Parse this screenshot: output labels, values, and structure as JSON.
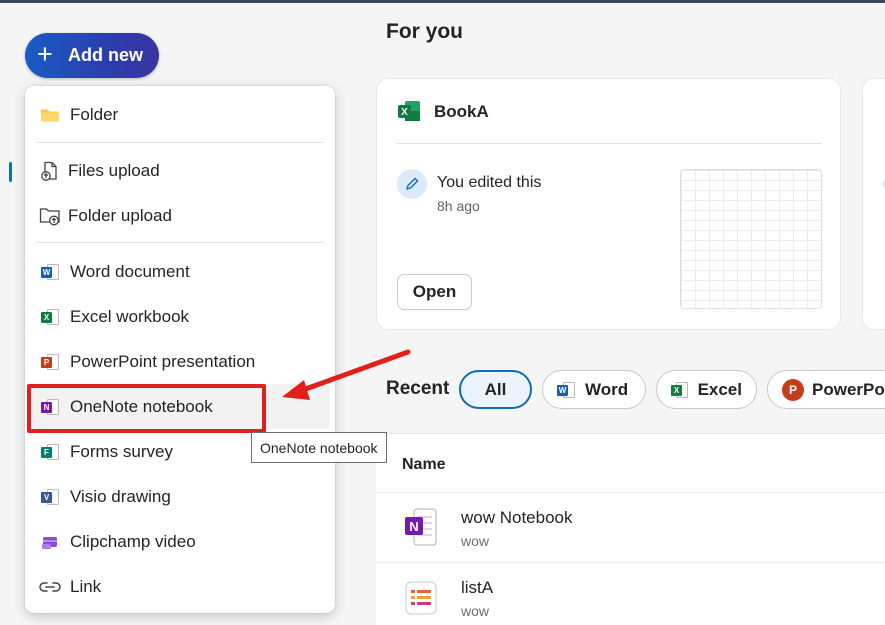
{
  "add_new": {
    "label": "Add new",
    "icon": "plus-icon"
  },
  "menu": {
    "items": [
      {
        "label": "Folder",
        "icon": "folder-icon"
      },
      {
        "label": "Files upload",
        "icon": "file-upload-icon"
      },
      {
        "label": "Folder upload",
        "icon": "folder-upload-icon"
      },
      {
        "label": "Word document",
        "icon": "word-icon"
      },
      {
        "label": "Excel workbook",
        "icon": "excel-icon"
      },
      {
        "label": "PowerPoint presentation",
        "icon": "powerpoint-icon"
      },
      {
        "label": "OneNote notebook",
        "icon": "onenote-icon"
      },
      {
        "label": "Forms survey",
        "icon": "forms-icon"
      },
      {
        "label": "Visio drawing",
        "icon": "visio-icon"
      },
      {
        "label": "Clipchamp video",
        "icon": "clipchamp-icon"
      },
      {
        "label": "Link",
        "icon": "link-icon"
      }
    ],
    "tooltip": "OneNote notebook"
  },
  "main": {
    "section_title": "For you",
    "card": {
      "title": "BookA",
      "activity": "You edited this",
      "time": "8h ago",
      "open_label": "Open"
    },
    "recent": {
      "label": "Recent",
      "filters": [
        "All",
        "Word",
        "Excel",
        "PowerPoi"
      ]
    },
    "list": {
      "header": "Name",
      "files": [
        {
          "name": "wow Notebook",
          "sub": "wow",
          "icon": "onenote-file-icon"
        },
        {
          "name": "listA",
          "sub": "wow",
          "icon": "list-file-icon"
        }
      ]
    }
  },
  "colors": {
    "accent": "#0f6cbd",
    "highlight_box": "#e0211b",
    "word": "#185abd",
    "excel": "#107c41",
    "powerpoint": "#c43e1c",
    "onenote": "#7719aa"
  }
}
